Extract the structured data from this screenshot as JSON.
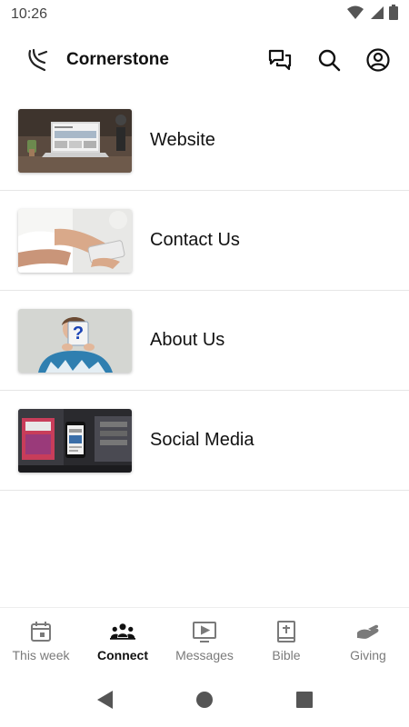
{
  "status_bar": {
    "time": "10:26",
    "icons": [
      "wifi-icon",
      "cell-signal-icon",
      "battery-icon"
    ]
  },
  "app_bar": {
    "title": "Cornerstone",
    "logo": "cornerstone-logo",
    "actions": [
      "chat-icon",
      "search-icon",
      "account-icon"
    ]
  },
  "menu_items": [
    {
      "label": "Website",
      "thumbnail": "laptop-on-desk"
    },
    {
      "label": "Contact Us",
      "thumbnail": "hand-holding-phone"
    },
    {
      "label": "About Us",
      "thumbnail": "person-holding-question-card"
    },
    {
      "label": "Social Media",
      "thumbnail": "phone-with-social-feed"
    }
  ],
  "bottom_nav": {
    "active": "Connect",
    "items": [
      {
        "label": "This week",
        "icon": "calendar-icon"
      },
      {
        "label": "Connect",
        "icon": "group-icon"
      },
      {
        "label": "Messages",
        "icon": "play-screen-icon"
      },
      {
        "label": "Bible",
        "icon": "bible-icon"
      },
      {
        "label": "Giving",
        "icon": "giving-hand-icon"
      }
    ]
  },
  "system_nav": [
    "back-icon",
    "home-icon",
    "recents-icon"
  ],
  "colors": {
    "active": "#111111",
    "inactive": "#7a7a7a",
    "divider": "#e6e6e6"
  }
}
